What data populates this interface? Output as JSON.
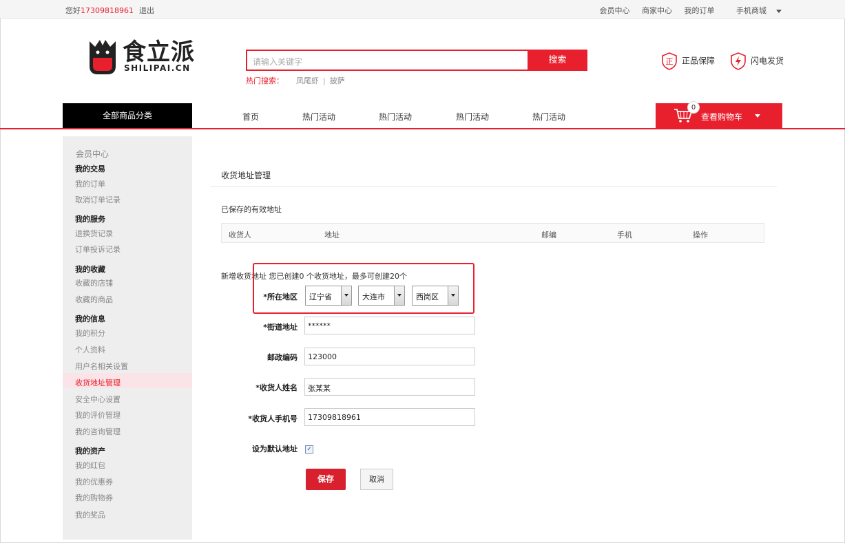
{
  "topbar": {
    "greeting": "您好",
    "phone": "17309818961",
    "logout": "退出",
    "links": [
      "会员中心",
      "商家中心",
      "我的订单",
      "手机商城"
    ]
  },
  "logo": {
    "brand": "食立派",
    "sub": "SHILIPAI.CN"
  },
  "search": {
    "placeholder": "请输入关键字",
    "button": "搜索",
    "hot_label": "热门搜索：",
    "hot_keywords": [
      "凤尾虾",
      "披萨"
    ],
    "hot_sep": "|"
  },
  "guarantees": [
    {
      "icon": "authentic-icon",
      "glyph": "正",
      "label": "正品保障"
    },
    {
      "icon": "lightning-icon",
      "label": "闪电发货"
    }
  ],
  "nav": {
    "category": "全部商品分类",
    "items": [
      "首页",
      "热门活动",
      "热门活动",
      "热门活动",
      "热门活动"
    ]
  },
  "cart": {
    "label": "查看购物车",
    "count": "0"
  },
  "sidebar": {
    "title": "会员中心",
    "groups": [
      {
        "label": "我的交易",
        "items": [
          "我的订单",
          "取消订单记录"
        ]
      },
      {
        "label": "我的服务",
        "items": [
          "退换货记录",
          "订单投诉记录"
        ]
      },
      {
        "label": "我的收藏",
        "items": [
          "收藏的店铺",
          "收藏的商品"
        ]
      },
      {
        "label": "我的信息",
        "items": [
          "我的积分",
          "个人资料",
          "用户名相关设置",
          "收货地址管理",
          "安全中心设置",
          "我的评价管理",
          "我的咨询管理"
        ]
      },
      {
        "label": "我的资产",
        "items": [
          "我的红包",
          "我的优惠券",
          "我的购物券",
          "我的奖品"
        ]
      }
    ]
  },
  "main": {
    "title": "收货地址管理",
    "saved_title": "已保存的有效地址",
    "table_headers": [
      "收货人",
      "地址",
      "邮编",
      "手机",
      "操作"
    ],
    "new_label": "新增收货地址 您已创建0 个收货地址，最多可创建20个",
    "form": {
      "region_label": "*所在地区",
      "province": "辽宁省",
      "city": "大连市",
      "district": "西岗区",
      "street_label": "*街道地址",
      "street_value": "******",
      "postcode_label": "邮政编码",
      "postcode_value": "123000",
      "name_label": "*收货人姓名",
      "name_value": "张某某",
      "phone_label": "*收货人手机号",
      "phone_value": "17309818961",
      "default_label": "设为默认地址",
      "default_checked": true
    },
    "save_button": "保存",
    "cancel_button": "取消"
  },
  "colors": {
    "accent": "#e8202e",
    "nav_black": "#000000",
    "sidebar_bg": "#eeeeee"
  }
}
